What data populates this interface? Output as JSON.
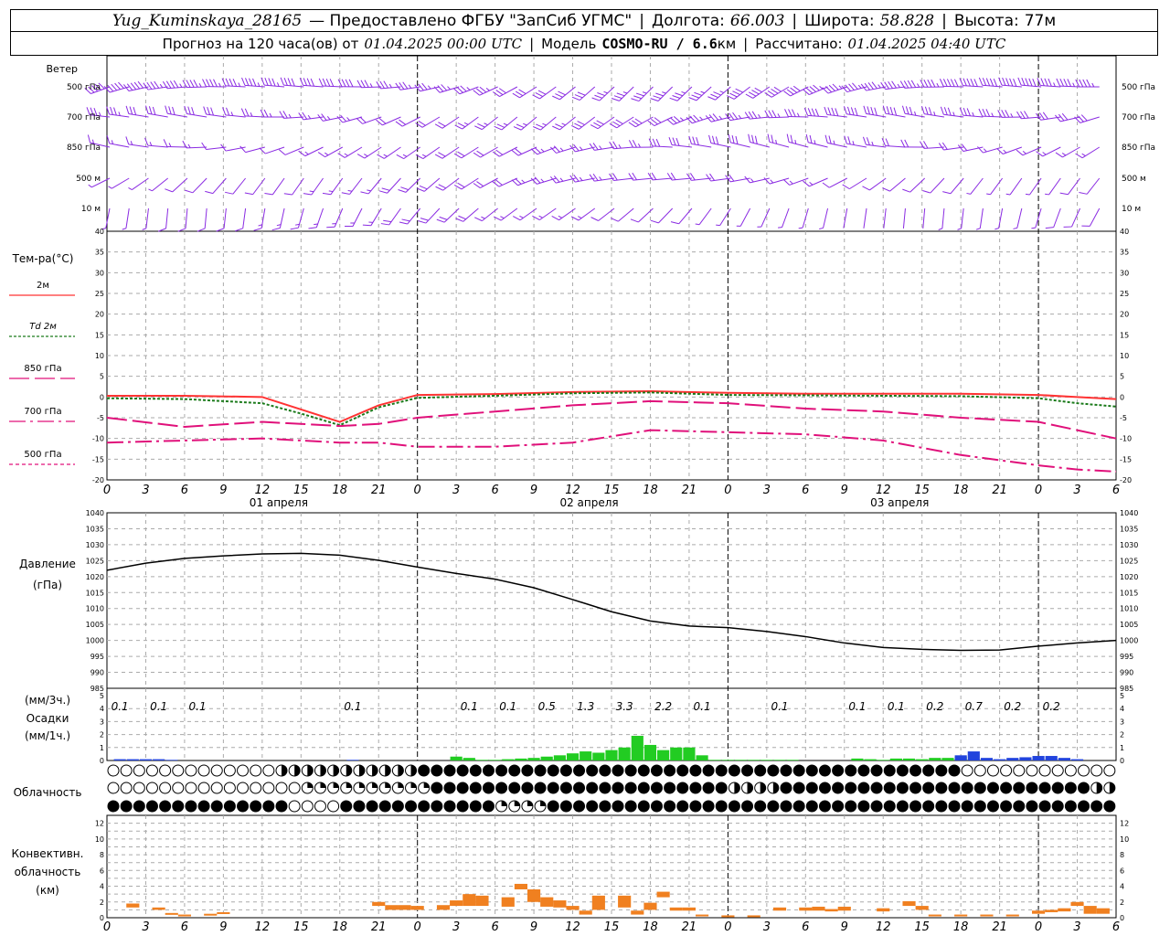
{
  "header": {
    "station": "Yug_Kuminskaya_28165",
    "provider": "— Предоставлено ФГБУ \"ЗапСиб УГМС\"",
    "lon_label": "Долгота:",
    "lon": "66.003",
    "lat_label": "Широта:",
    "lat": "58.828",
    "alt_label": "Высота:",
    "alt": "77м",
    "forecast_prefix": "Прогноз на 120 часа(ов) от",
    "forecast_from": "01.04.2025 00:00 UTC",
    "model_label": "Модель",
    "model": "COSMO-RU / 6.6",
    "model_unit": "км",
    "calc_label": "Рассчитано:",
    "calc": "01.04.2025 04:40 UTC"
  },
  "wind_panel": {
    "title": "Ветер",
    "levels": [
      "500 гПа",
      "700 гПа",
      "850 гПа",
      "500 м",
      "10  м"
    ]
  },
  "temp_panel": {
    "title": "Тем-ра(°С)",
    "legend": [
      {
        "label": "2м",
        "color": "#ff3333",
        "dash": ""
      },
      {
        "label": "Td 2м",
        "color": "#1a7a1a",
        "dash": "3,2"
      },
      {
        "label": "850 гПа",
        "color": "#e0107a",
        "dash": "22,6"
      },
      {
        "label": "700 гПа",
        "color": "#e0107a",
        "dash": "18,5,3,5"
      },
      {
        "label": "500 гПа",
        "color": "#e0107a",
        "dash": "4,3"
      }
    ],
    "date_labels": [
      "01 апреля",
      "02 апреля",
      "03 апреля"
    ]
  },
  "pressure_panel": {
    "title_line1": "Давление",
    "title_line2": "(гПа)"
  },
  "precip_panel": {
    "title_line1": "(мм/3ч.)",
    "title_line2": "Осадки",
    "title_line3": "(мм/1ч.)",
    "labels3h": [
      {
        "h": 1,
        "v": "0.1"
      },
      {
        "h": 4,
        "v": "0.1"
      },
      {
        "h": 7,
        "v": "0.1"
      },
      {
        "h": 19,
        "v": "0.1"
      },
      {
        "h": 28,
        "v": "0.1"
      },
      {
        "h": 31,
        "v": "0.1"
      },
      {
        "h": 34,
        "v": "0.5"
      },
      {
        "h": 37,
        "v": "1.3"
      },
      {
        "h": 40,
        "v": "3.3"
      },
      {
        "h": 43,
        "v": "2.2"
      },
      {
        "h": 46,
        "v": "0.1"
      },
      {
        "h": 52,
        "v": "0.1"
      },
      {
        "h": 58,
        "v": "0.1"
      },
      {
        "h": 61,
        "v": "0.1"
      },
      {
        "h": 64,
        "v": "0.2"
      },
      {
        "h": 67,
        "v": "0.7"
      },
      {
        "h": 70,
        "v": "0.2"
      },
      {
        "h": 73,
        "v": "0.2"
      }
    ]
  },
  "cloud_panel": {
    "title": "Облачность"
  },
  "conv_panel": {
    "title_line1": "Конвективн.",
    "title_line2": "облачность",
    "title_line3": "(км)"
  },
  "x_ticks": [
    "0",
    "3",
    "6",
    "9",
    "12",
    "15",
    "18",
    "21",
    "0",
    "3",
    "6",
    "9",
    "12",
    "15",
    "18",
    "21",
    "0",
    "3",
    "6",
    "9",
    "12",
    "15",
    "18",
    "21",
    "0",
    "3",
    "6"
  ],
  "colors": {
    "wind": "#8a2be2",
    "t2m": "#ff3333",
    "td2m": "#1a7a1a",
    "upper": "#e0107a",
    "pressure": "#000000",
    "rain": "#22cc22",
    "snow": "#2244dd",
    "conv": "#f08020"
  },
  "chart_data": [
    {
      "type": "line",
      "title": "Тем-ра(°С)",
      "x_unit": "hours since 01.04.2025 00:00 UTC",
      "ylim": [
        -20,
        40
      ],
      "x": [
        0,
        6,
        12,
        15,
        18,
        21,
        24,
        30,
        36,
        42,
        48,
        54,
        60,
        66,
        72,
        75,
        78
      ],
      "series": [
        {
          "name": "2м",
          "values": [
            0.3,
            0.3,
            0,
            -3,
            -6,
            -2,
            0.5,
            0.7,
            1.2,
            1.4,
            1.0,
            0.8,
            0.8,
            0.8,
            0.5,
            0,
            -0.5
          ]
        },
        {
          "name": "Td 2м",
          "values": [
            -0.3,
            -0.5,
            -1.5,
            -4,
            -6.8,
            -2.5,
            -0.2,
            0.3,
            0.9,
            1.1,
            0.5,
            0.4,
            0.3,
            0.2,
            -0.3,
            -1.5,
            -2.3
          ]
        },
        {
          "name": "850 гПа",
          "values": [
            -5,
            -7.2,
            -6,
            -6.5,
            -7,
            -6.5,
            -5,
            -3.5,
            -2,
            -1,
            -1.5,
            -2.8,
            -3.5,
            -5,
            -6,
            -8,
            -10
          ]
        },
        {
          "name": "700 гПа",
          "values": [
            -11,
            -10.5,
            -10,
            -10.5,
            -11,
            -11,
            -12,
            -12,
            -11,
            -8,
            -8.5,
            -9,
            -10.5,
            -14,
            -16.5,
            -17.5,
            -18
          ]
        },
        {
          "name": "500 гПа",
          "values": []
        }
      ]
    },
    {
      "type": "line",
      "title": "Давление (гПа)",
      "x_unit": "hours since 01.04.2025 00:00 UTC",
      "ylim": [
        985,
        1040
      ],
      "x": [
        0,
        3,
        6,
        9,
        12,
        15,
        18,
        21,
        24,
        27,
        30,
        33,
        36,
        39,
        42,
        45,
        48,
        51,
        54,
        57,
        60,
        63,
        66,
        69,
        72,
        75,
        78
      ],
      "values": [
        1022,
        1024.2,
        1025.7,
        1026.5,
        1027.1,
        1027.3,
        1026.7,
        1025.1,
        1023,
        1021,
        1019.2,
        1016.5,
        1012.8,
        1009,
        1006.1,
        1004.5,
        1004,
        1002.8,
        1001.2,
        999.2,
        997.8,
        997.2,
        996.9,
        997,
        998.2,
        999.2,
        1000
      ]
    },
    {
      "type": "bar",
      "title": "Осадки (мм/1ч.)",
      "x_unit": "hours since 01.04.2025 00:00 UTC",
      "ylim": [
        0,
        5
      ],
      "series": [
        {
          "name": "rain",
          "x": [
            27,
            28,
            29,
            30,
            31,
            32,
            33,
            34,
            35,
            36,
            37,
            38,
            39,
            40,
            41,
            42,
            43,
            44,
            45,
            46,
            47,
            48,
            49,
            50,
            51,
            52,
            53,
            58,
            59,
            60,
            61,
            62,
            63,
            64,
            65,
            66
          ],
          "values": [
            0.3,
            0.2,
            0.05,
            0.05,
            0.1,
            0.15,
            0.2,
            0.3,
            0.4,
            0.55,
            0.7,
            0.6,
            0.8,
            1.0,
            1.9,
            1.2,
            0.8,
            1.0,
            1.0,
            0.4,
            0.05,
            0.05,
            0.05,
            0.05,
            0.05,
            0.05,
            0.05,
            0.15,
            0.1,
            0.05,
            0.15,
            0.15,
            0.1,
            0.2,
            0.2,
            0.3
          ]
        },
        {
          "name": "snow",
          "x": [
            1,
            2,
            3,
            4,
            5,
            19,
            66,
            67,
            68,
            69,
            70,
            71,
            72,
            73,
            74,
            75
          ],
          "values": [
            0.1,
            0.1,
            0.1,
            0.1,
            0.05,
            0.05,
            0.4,
            0.7,
            0.2,
            0.1,
            0.2,
            0.25,
            0.35,
            0.35,
            0.2,
            0.1
          ]
        }
      ]
    },
    {
      "type": "bar",
      "title": "Конвективн. облачность (км)",
      "x_unit": "hours since 01.04.2025 00:00 UTC",
      "ylim": [
        0,
        13
      ],
      "series": [
        {
          "name": "top",
          "x": [
            2,
            4,
            5,
            6,
            8,
            9,
            21,
            22,
            23,
            24,
            26,
            27,
            28,
            29,
            31,
            32,
            33,
            34,
            35,
            36,
            37,
            38,
            40,
            41,
            42,
            43,
            44,
            45,
            46,
            48,
            50,
            52,
            54,
            55,
            56,
            57,
            60,
            62,
            63,
            64,
            66,
            68,
            70,
            72,
            73,
            74,
            75,
            76,
            77
          ],
          "values": [
            1.8,
            1.3,
            0.6,
            0.4,
            0.5,
            0.7,
            2,
            1.6,
            1.6,
            1.5,
            1.6,
            2.2,
            3,
            2.8,
            2.6,
            4.3,
            3.6,
            2.6,
            2.2,
            1.5,
            0.9,
            2.8,
            2.8,
            0.9,
            1.9,
            3.3,
            1.3,
            1.3,
            0.4,
            0.3,
            0.3,
            1.3,
            1.3,
            1.4,
            1.1,
            1.4,
            1.2,
            2.1,
            1.5,
            0.4,
            0.4,
            0.4,
            0.4,
            0.9,
            1,
            1.2,
            2,
            1.5,
            1.2
          ]
        },
        {
          "name": "base",
          "x": [
            2,
            4,
            5,
            6,
            8,
            9,
            21,
            22,
            23,
            24,
            26,
            27,
            28,
            29,
            31,
            32,
            33,
            34,
            35,
            36,
            37,
            38,
            40,
            41,
            42,
            43,
            44,
            45,
            46,
            48,
            50,
            52,
            54,
            55,
            56,
            57,
            60,
            62,
            63,
            64,
            66,
            68,
            70,
            72,
            73,
            74,
            75,
            76,
            77
          ],
          "values": [
            1.3,
            1,
            0.4,
            0.3,
            0.4,
            0.5,
            1.5,
            1,
            1,
            1,
            1,
            1.5,
            1.5,
            1.5,
            1.4,
            3.6,
            2,
            1.4,
            1.3,
            1,
            0.4,
            1,
            1.3,
            0.4,
            1,
            2.6,
            0.9,
            0.9,
            0.3,
            0.2,
            0.2,
            0.9,
            0.9,
            0.9,
            0.8,
            0.9,
            0.8,
            1.5,
            1,
            0.3,
            0.3,
            0.3,
            0.3,
            0.5,
            0.7,
            0.8,
            1.5,
            0.5,
            0.5
          ]
        }
      ]
    }
  ]
}
